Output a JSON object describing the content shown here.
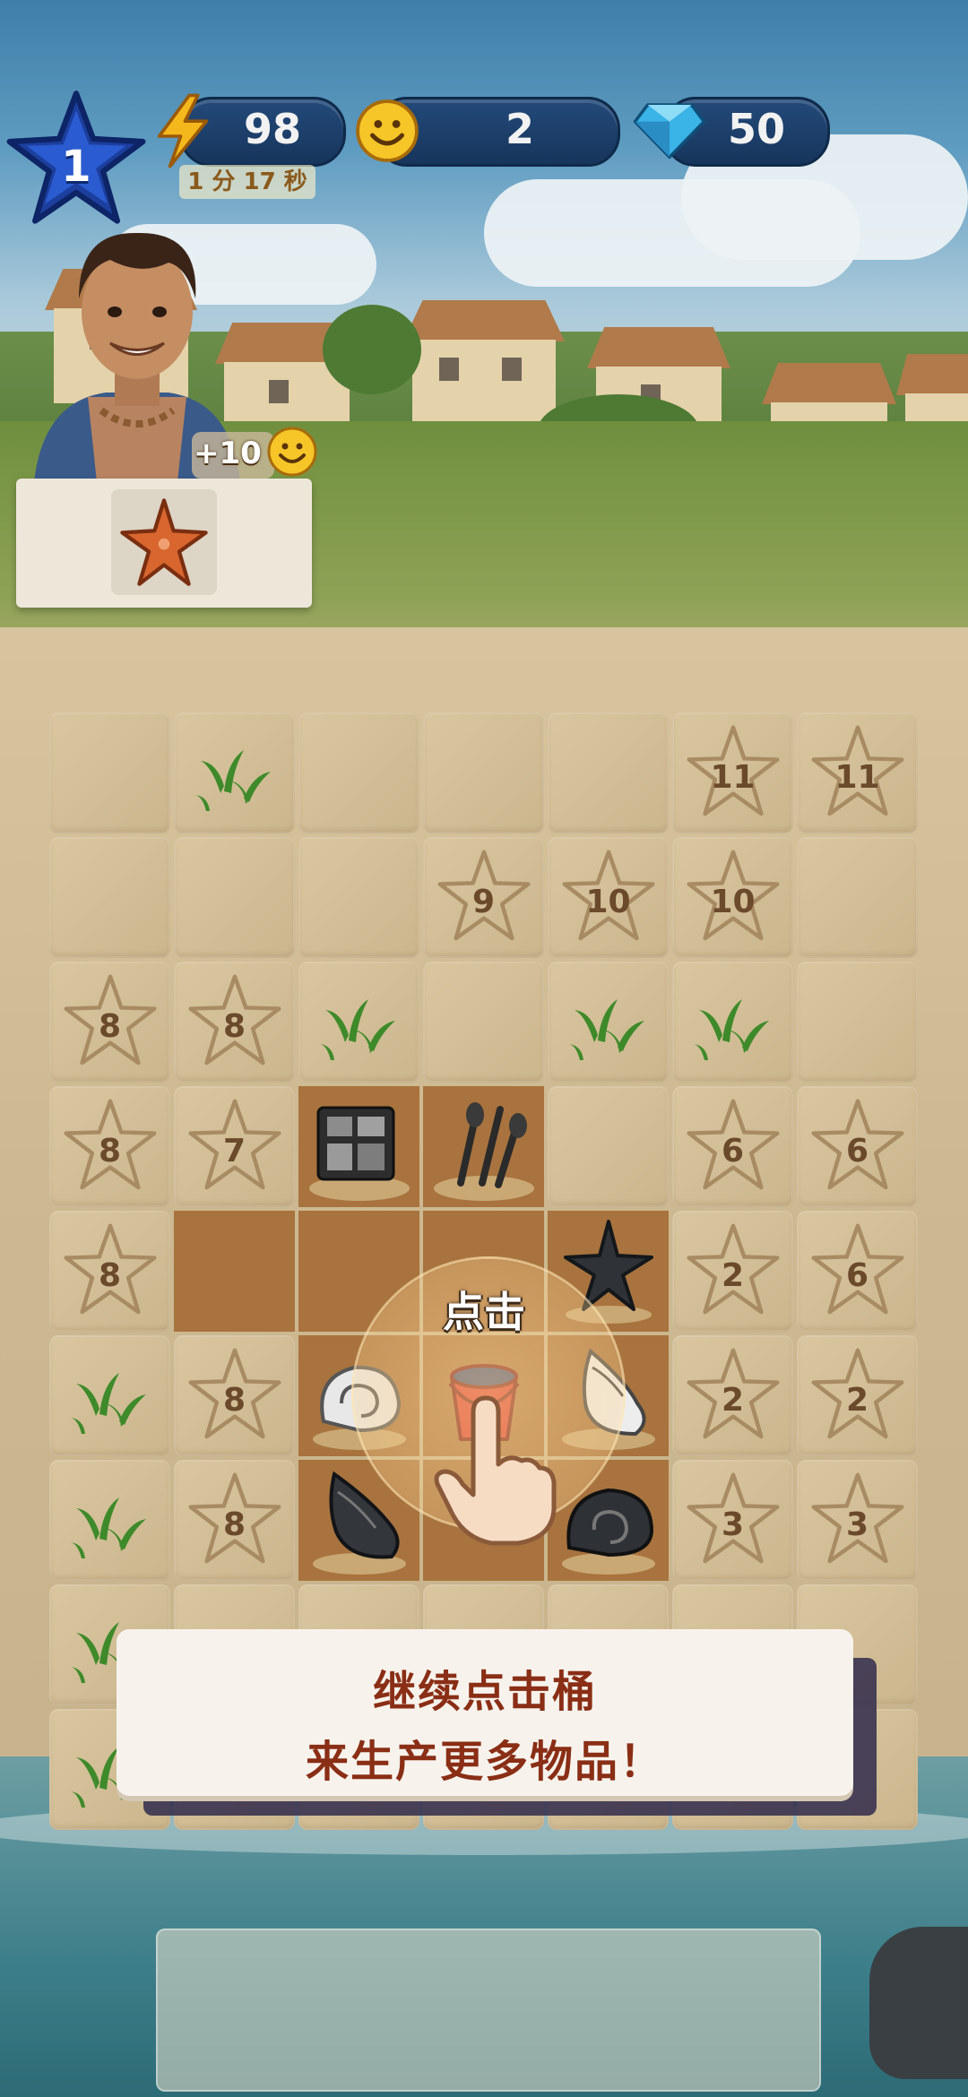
{
  "hud": {
    "level": "1",
    "energy": "98",
    "energy_timer": "1 分 17 秒",
    "smiles": "2",
    "gems": "50"
  },
  "order": {
    "reward": "+10",
    "item_icon": "starfish-icon"
  },
  "board": {
    "rows": [
      [
        {
          "t": "sand"
        },
        {
          "t": "grass"
        },
        {
          "t": "sand"
        },
        {
          "t": "sand"
        },
        {
          "t": "sand"
        },
        {
          "t": "star",
          "n": "11"
        },
        {
          "t": "star",
          "n": "11"
        }
      ],
      [
        {
          "t": "sand"
        },
        {
          "t": "sand"
        },
        {
          "t": "sand"
        },
        {
          "t": "star",
          "n": "9"
        },
        {
          "t": "star",
          "n": "10"
        },
        {
          "t": "star",
          "n": "10"
        },
        {
          "t": "sand"
        }
      ],
      [
        {
          "t": "star",
          "n": "8"
        },
        {
          "t": "star",
          "n": "8"
        },
        {
          "t": "grass"
        },
        {
          "t": "sand"
        },
        {
          "t": "grass"
        },
        {
          "t": "grass"
        },
        {
          "t": "sand"
        }
      ],
      [
        {
          "t": "star",
          "n": "8"
        },
        {
          "t": "star",
          "n": "7"
        },
        {
          "t": "item",
          "i": "photo-album-icon"
        },
        {
          "t": "item",
          "i": "cutlery-icon"
        },
        {
          "t": "sand"
        },
        {
          "t": "star",
          "n": "6"
        },
        {
          "t": "star",
          "n": "6"
        }
      ],
      [
        {
          "t": "star",
          "n": "8"
        },
        {
          "t": "open"
        },
        {
          "t": "open"
        },
        {
          "t": "open"
        },
        {
          "t": "item",
          "i": "starfish-icon"
        },
        {
          "t": "star",
          "n": "2"
        },
        {
          "t": "star",
          "n": "6"
        }
      ],
      [
        {
          "t": "grass"
        },
        {
          "t": "star",
          "n": "8"
        },
        {
          "t": "item",
          "i": "white-snail-shell-icon"
        },
        {
          "t": "item",
          "i": "bucket-icon"
        },
        {
          "t": "item",
          "i": "conch-shell-icon"
        },
        {
          "t": "star",
          "n": "2"
        },
        {
          "t": "star",
          "n": "2"
        }
      ],
      [
        {
          "t": "grass"
        },
        {
          "t": "star",
          "n": "8"
        },
        {
          "t": "item",
          "i": "black-conch-icon"
        },
        {
          "t": "open"
        },
        {
          "t": "item",
          "i": "black-snail-shell-icon"
        },
        {
          "t": "star",
          "n": "3"
        },
        {
          "t": "star",
          "n": "3"
        }
      ],
      [
        {
          "t": "grass"
        },
        {
          "t": "sand"
        },
        {
          "t": "sand"
        },
        {
          "t": "sand"
        },
        {
          "t": "sand"
        },
        {
          "t": "sand"
        },
        {
          "t": "sand"
        }
      ],
      [
        {
          "t": "grass"
        },
        {
          "t": "sand"
        },
        {
          "t": "sand"
        },
        {
          "t": "sand"
        },
        {
          "t": "sand"
        },
        {
          "t": "sand"
        },
        {
          "t": "sand"
        }
      ]
    ]
  },
  "tutorial": {
    "tap_label": "点击",
    "message_line1": "继续点击桶",
    "message_line2": "来生产更多物品！"
  },
  "colors": {
    "hud_pill": "#1d4170",
    "banner_text": "#8a2e16",
    "open_cell": "#a8733e"
  }
}
